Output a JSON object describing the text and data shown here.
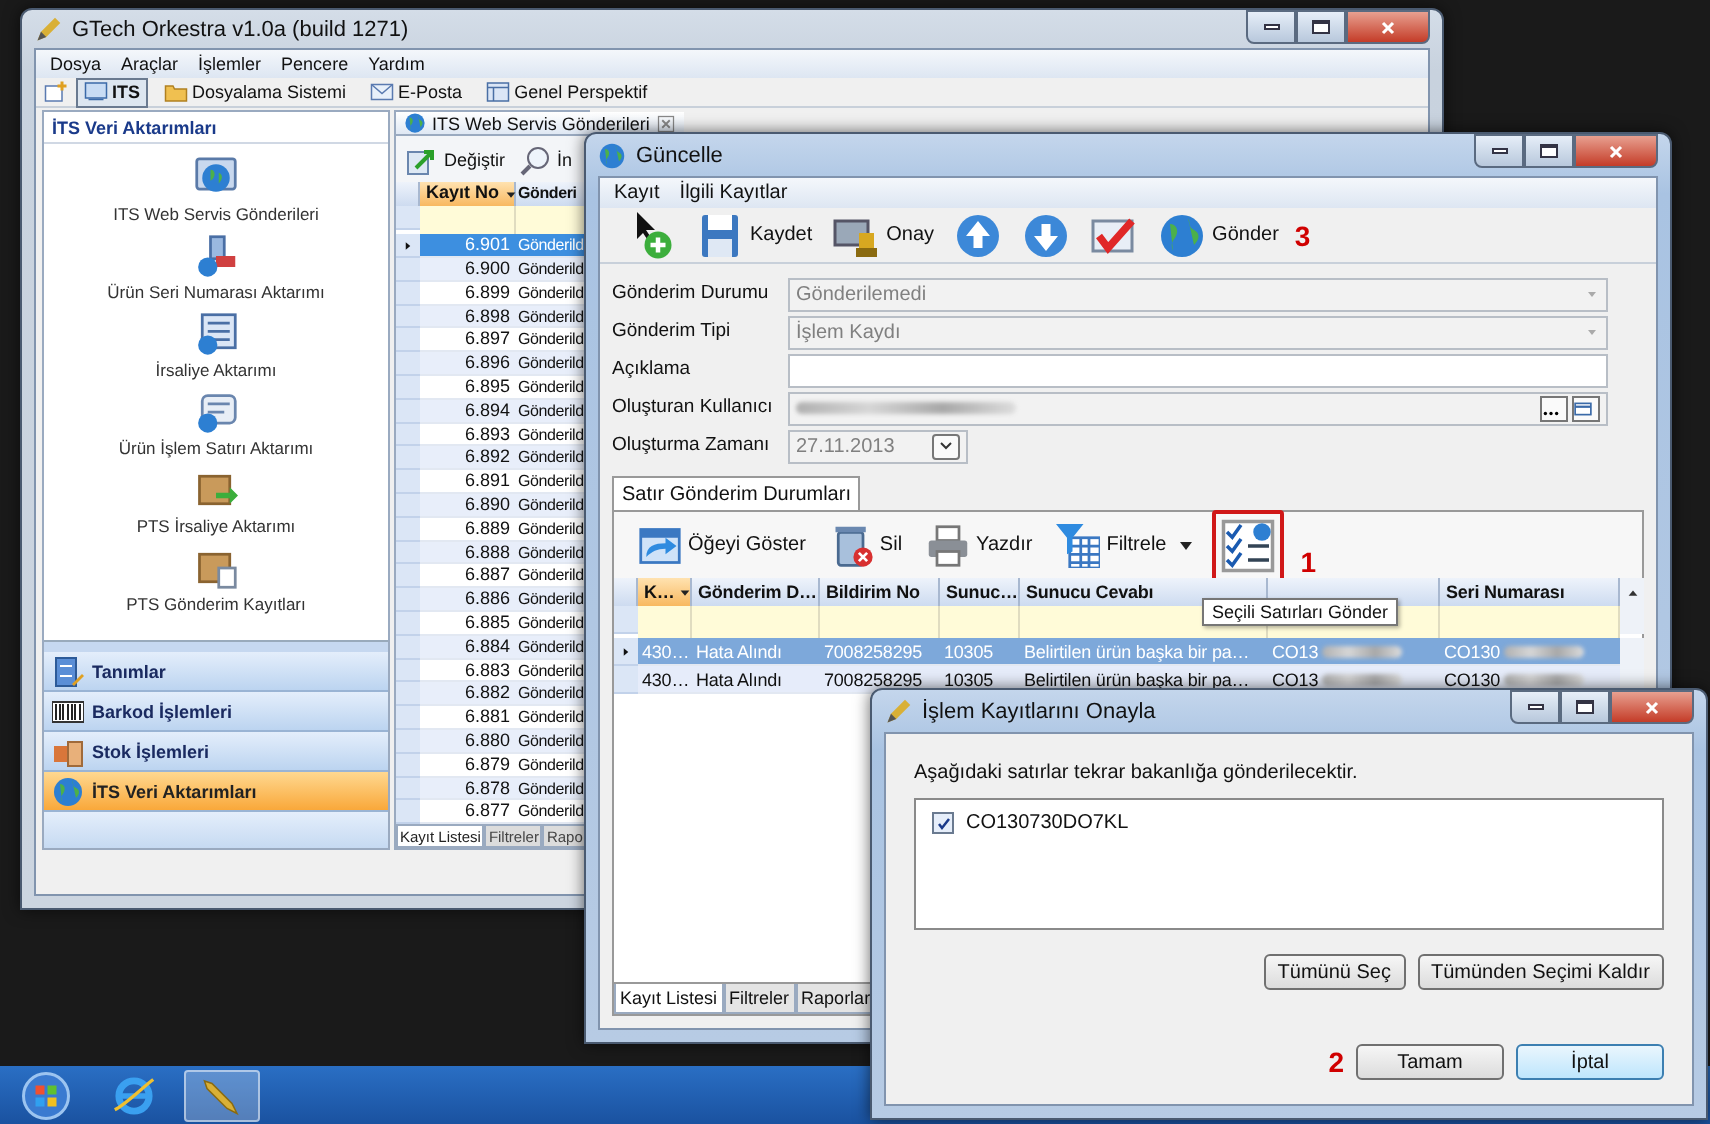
{
  "main_window": {
    "title": "GTech Orkestra v1.0a (build 1271)",
    "menu": [
      "Dosya",
      "Araçlar",
      "İşlemler",
      "Pencere",
      "Yardım"
    ],
    "perspectives": [
      {
        "label": "ITS",
        "selected": true
      },
      {
        "label": "Dosyalama Sistemi",
        "selected": false
      },
      {
        "label": "E-Posta",
        "selected": false
      },
      {
        "label": "Genel Perspektif",
        "selected": false
      }
    ],
    "sidebar": {
      "title": "İTS Veri Aktarımları",
      "items": [
        "ITS Web Servis Gönderileri",
        "Ürün Seri Numarası Aktarımı",
        "İrsaliye Aktarımı",
        "Ürün İşlem Satırı Aktarımı",
        "PTS İrsaliye Aktarımı",
        "PTS Gönderim Kayıtları"
      ],
      "sections": [
        {
          "label": "Tanımlar",
          "selected": false
        },
        {
          "label": "Barkod İşlemleri",
          "selected": false
        },
        {
          "label": "Stok İşlemleri",
          "selected": false
        },
        {
          "label": "İTS Veri Aktarımları",
          "selected": true
        }
      ]
    },
    "editor": {
      "tab": "ITS Web Servis Gönderileri",
      "toolbar": [
        "Değiştir",
        "İn"
      ],
      "columns": [
        {
          "label": "Kayıt No",
          "sorted": true
        },
        {
          "label": "Gönderi",
          "sorted": false
        }
      ],
      "rows": [
        {
          "cells": [
            "6.901",
            "Gönderild"
          ],
          "selected": true
        },
        {
          "cells": [
            "6.900",
            "Gönderild"
          ],
          "selected": false
        },
        {
          "cells": [
            "6.899",
            "Gönderild"
          ],
          "selected": false
        },
        {
          "cells": [
            "6.898",
            "Gönderild"
          ],
          "selected": false
        },
        {
          "cells": [
            "6.897",
            "Gönderild"
          ],
          "selected": false
        },
        {
          "cells": [
            "6.896",
            "Gönderild"
          ],
          "selected": false
        },
        {
          "cells": [
            "6.895",
            "Gönderild"
          ],
          "selected": false
        },
        {
          "cells": [
            "6.894",
            "Gönderild"
          ],
          "selected": false
        },
        {
          "cells": [
            "6.893",
            "Gönderild"
          ],
          "selected": false
        },
        {
          "cells": [
            "6.892",
            "Gönderild"
          ],
          "selected": false
        },
        {
          "cells": [
            "6.891",
            "Gönderild"
          ],
          "selected": false
        },
        {
          "cells": [
            "6.890",
            "Gönderild"
          ],
          "selected": false
        },
        {
          "cells": [
            "6.889",
            "Gönderild"
          ],
          "selected": false
        },
        {
          "cells": [
            "6.888",
            "Gönderild"
          ],
          "selected": false
        },
        {
          "cells": [
            "6.887",
            "Gönderild"
          ],
          "selected": false
        },
        {
          "cells": [
            "6.886",
            "Gönderild"
          ],
          "selected": false
        },
        {
          "cells": [
            "6.885",
            "Gönderild"
          ],
          "selected": false
        },
        {
          "cells": [
            "6.884",
            "Gönderild"
          ],
          "selected": false
        },
        {
          "cells": [
            "6.883",
            "Gönderild"
          ],
          "selected": false
        },
        {
          "cells": [
            "6.882",
            "Gönderild"
          ],
          "selected": false
        },
        {
          "cells": [
            "6.881",
            "Gönderild"
          ],
          "selected": false
        },
        {
          "cells": [
            "6.880",
            "Gönderild"
          ],
          "selected": false
        },
        {
          "cells": [
            "6.879",
            "Gönderild"
          ],
          "selected": false
        },
        {
          "cells": [
            "6.878",
            "Gönderild"
          ],
          "selected": false
        },
        {
          "cells": [
            "6.877",
            "Gönderild"
          ],
          "selected": false
        }
      ],
      "bottom_tabs": [
        {
          "label": "Kayıt Listesi",
          "selected": true
        },
        {
          "label": "Filtreler",
          "selected": false
        },
        {
          "label": "Rapo",
          "selected": false
        }
      ]
    }
  },
  "update_window": {
    "title": "Güncelle",
    "menu": [
      "Kayıt",
      "İlgili Kayıtlar"
    ],
    "toolbar": {
      "save": "Kaydet",
      "approve": "Onay",
      "send": "Gönder",
      "callout": "3"
    },
    "fields": [
      {
        "label": "Gönderim Durumu",
        "kind": "combo",
        "value": "Gönderilemedi",
        "disabled": true
      },
      {
        "label": "Gönderim Tipi",
        "kind": "combo",
        "value": "İşlem Kaydı",
        "disabled": true
      },
      {
        "label": "Açıklama",
        "kind": "text",
        "disabled": false
      },
      {
        "label": "Oluşturan Kullanıcı",
        "kind": "lookup",
        "disabled": true
      },
      {
        "label": "Oluşturma Zamanı",
        "kind": "date",
        "value": "27.11.2013",
        "disabled": true
      }
    ],
    "tab": {
      "label": "Satır Gönderim Durumları",
      "selected": true
    },
    "grid_toolbar": [
      {
        "label": "Öğeyi Göster",
        "dropdown": false
      },
      {
        "label": "Sil",
        "dropdown": false
      },
      {
        "label": "Yazdır",
        "dropdown": false
      },
      {
        "label": "Filtrele",
        "dropdown": true
      }
    ],
    "send_selected": {
      "tooltip": "Seçili Satırları Gönder",
      "highlighted": true,
      "callout": "1"
    },
    "columns": [
      {
        "label": "K…",
        "sorted": true
      },
      {
        "label": "Gönderim D…",
        "sorted": false
      },
      {
        "label": "Bildirim No",
        "sorted": false
      },
      {
        "label": "Sunuc…",
        "sorted": false
      },
      {
        "label": "Sunucu Cevabı",
        "sorted": false
      },
      {
        "sorted": false
      },
      {
        "label": "Seri Numarası",
        "sorted": false
      }
    ],
    "rows": [
      {
        "cells": [
          "430…",
          "Hata Alındı",
          "7008258295",
          "10305",
          "Belirtilen ürün başka bir pa…",
          "CO13",
          "CO130"
        ],
        "selected": true
      },
      {
        "cells": [
          "430…",
          "Hata Alındı",
          "7008258295",
          "10305",
          "Belirtilen ürün başka bir pa…",
          "CO13",
          "CO130"
        ],
        "selected": false
      }
    ],
    "bottom_tabs": [
      {
        "label": "Kayıt Listesi",
        "selected": true
      },
      {
        "label": "Filtreler",
        "selected": false
      },
      {
        "label": "Raporlar",
        "selected": false
      }
    ]
  },
  "confirm_dialog": {
    "title": "İşlem Kayıtlarını Onayla",
    "message": "Aşağıdaki satırlar tekrar bakanlığa gönderilecektir.",
    "items": [
      {
        "label": "CO130730DO7KL",
        "checked": true
      }
    ],
    "list_buttons": [
      "Tümünü Seç",
      "Tümünden Seçimi Kaldır"
    ],
    "ok": {
      "label": "Tamam",
      "callout": "2"
    },
    "cancel": {
      "label": "İptal",
      "default": true
    }
  }
}
